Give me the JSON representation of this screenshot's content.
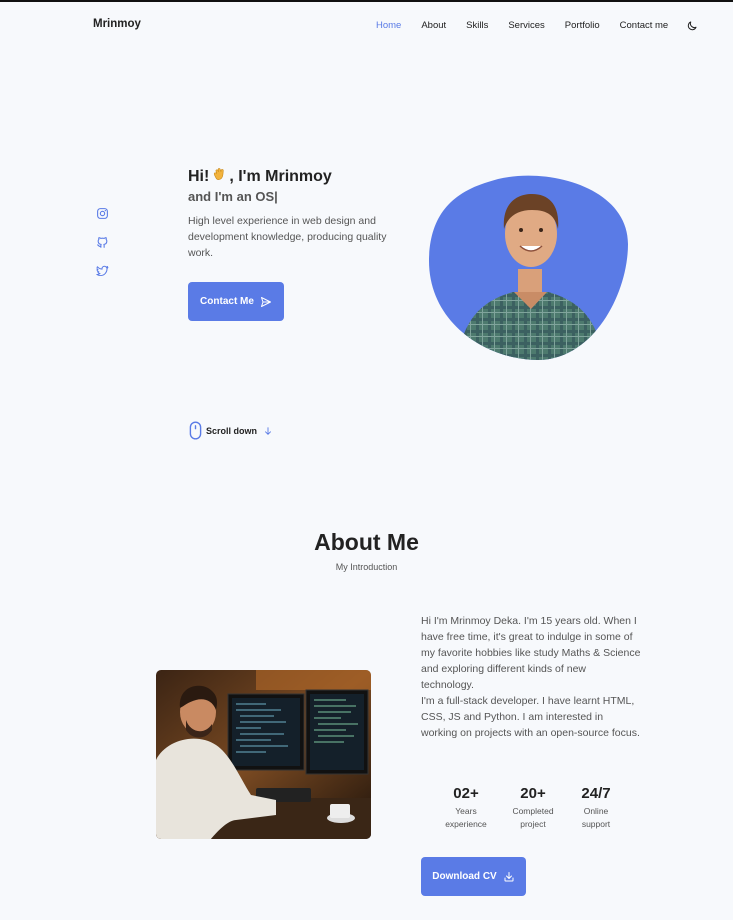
{
  "header": {
    "logo": "Mrinmoy",
    "nav": [
      "Home",
      "About",
      "Skills",
      "Services",
      "Portfolio",
      "Contact me"
    ],
    "active_nav": "Home",
    "theme_icon": "moon-icon"
  },
  "socials": [
    "instagram-icon",
    "github-icon",
    "twitter-icon"
  ],
  "hero": {
    "greeting_pre": "Hi!",
    "greeting_post": ", I'm Mrinmoy",
    "subtitle": "and I'm an OS|",
    "description": "High level experience in web design and development knowledge, producing quality work.",
    "button_label": "Contact Me"
  },
  "scroll": {
    "label": "Scroll down"
  },
  "about": {
    "title": "About Me",
    "subtitle": "My Introduction",
    "paragraph1": "Hi I'm Mrinmoy Deka. I'm 15 years old. When I have free time, it's great to indulge in some of my favorite hobbies like study Maths & Science and exploring different kinds of new technology.",
    "paragraph2": "I'm a full-stack developer. I have learnt HTML, CSS, JS and Python. I am interested in working on projects with an open-source focus.",
    "stats": [
      {
        "num": "02+",
        "line1": "Years",
        "line2": "experience"
      },
      {
        "num": "20+",
        "line1": "Completed",
        "line2": "project"
      },
      {
        "num": "24/7",
        "line1": "Online",
        "line2": "support"
      }
    ],
    "button_label": "Download CV"
  },
  "colors": {
    "accent": "#5a7be6",
    "background": "#f7f9fc",
    "text": "#222222",
    "muted": "#555555"
  }
}
